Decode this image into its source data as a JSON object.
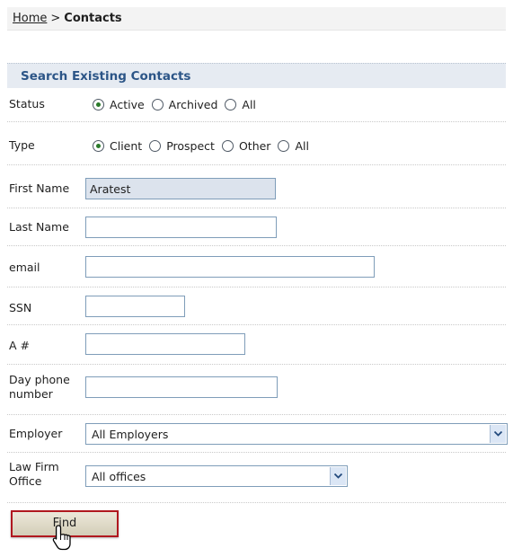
{
  "breadcrumb": {
    "home": "Home",
    "separator": ">",
    "current": "Contacts"
  },
  "panel": {
    "title": "Search Existing Contacts"
  },
  "status": {
    "label": "Status",
    "options": [
      "Active",
      "Archived",
      "All"
    ],
    "selected": "Active"
  },
  "type": {
    "label": "Type",
    "options": [
      "Client",
      "Prospect",
      "Other",
      "All"
    ],
    "selected": "Client"
  },
  "fields": {
    "first_name": {
      "label": "First Name",
      "value": "Aratest"
    },
    "last_name": {
      "label": "Last Name",
      "value": ""
    },
    "email": {
      "label": "email",
      "value": ""
    },
    "ssn": {
      "label": "SSN",
      "value": ""
    },
    "a_number": {
      "label": "A #",
      "value": ""
    },
    "day_phone": {
      "label_line1": "Day phone",
      "label_line2": "number",
      "value": ""
    }
  },
  "employer": {
    "label": "Employer",
    "selected": "All Employers"
  },
  "law_firm_office": {
    "label_line1": "Law Firm",
    "label_line2": "Office",
    "selected": "All offices"
  },
  "actions": {
    "find_label": "Find"
  },
  "colors": {
    "accent": "#2c5587",
    "button_border": "#b0181f",
    "panel_bg": "#e6ebf2"
  }
}
